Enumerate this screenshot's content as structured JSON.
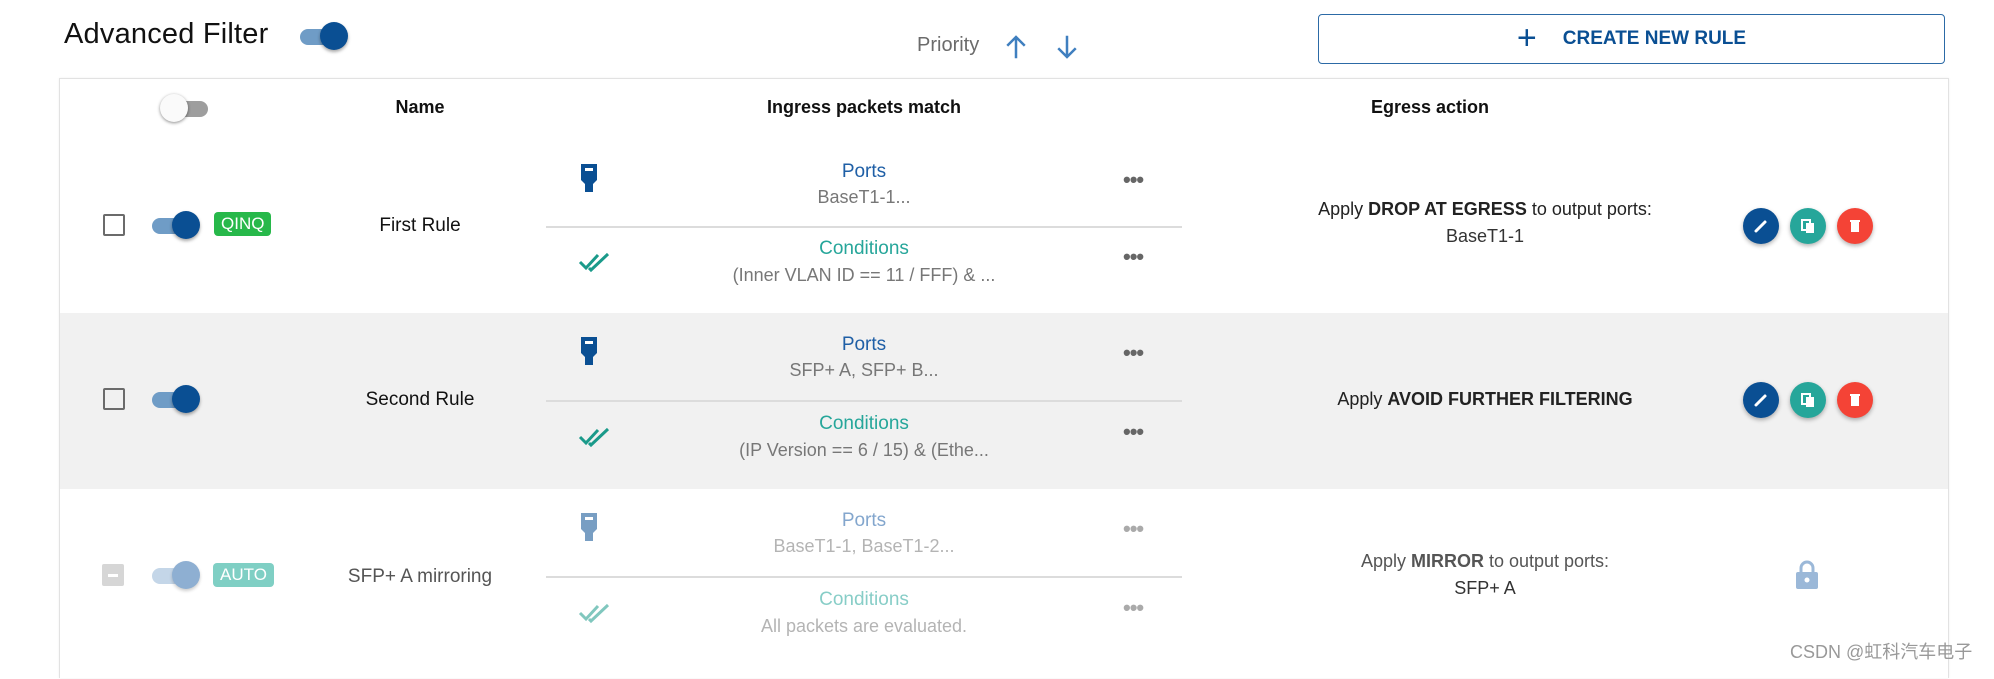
{
  "header": {
    "title": "Advanced Filter",
    "filter_enabled": true,
    "priority_label": "Priority",
    "create_button_label": "CREATE NEW RULE"
  },
  "table": {
    "columns": {
      "select_all_toggle": false,
      "name": "Name",
      "ingress": "Ingress packets match",
      "egress": "Egress action"
    },
    "rows": [
      {
        "checked": false,
        "enabled": true,
        "badge": "QINQ",
        "badge_color": "#27b84a",
        "name": "First Rule",
        "ports_label": "Ports",
        "ports_value": "BaseT1-1...",
        "conditions_label": "Conditions",
        "conditions_value": "(Inner VLAN ID == 11 / FFF) & ...",
        "egress_prefix": "Apply ",
        "egress_action": "DROP AT EGRESS",
        "egress_suffix": " to output ports:",
        "egress_ports": "BaseT1-1",
        "locked": false
      },
      {
        "checked": false,
        "enabled": true,
        "badge": "",
        "name": "Second Rule",
        "ports_label": "Ports",
        "ports_value": "SFP+ A, SFP+ B...",
        "conditions_label": "Conditions",
        "conditions_value": "(IP Version == 6 / 15) & (Ethe...",
        "egress_prefix": "Apply ",
        "egress_action": "AVOID FURTHER FILTERING",
        "egress_suffix": "",
        "egress_ports": "",
        "locked": false
      },
      {
        "checked": "indeterminate",
        "enabled": true,
        "disabled": true,
        "badge": "AUTO",
        "badge_color": "#7fcfc4",
        "name": "SFP+ A mirroring",
        "ports_label": "Ports",
        "ports_value": "BaseT1-1, BaseT1-2...",
        "conditions_label": "Conditions",
        "conditions_value": "All packets are evaluated.",
        "egress_prefix": "Apply ",
        "egress_action": "MIRROR",
        "egress_suffix": " to output ports:",
        "egress_ports": "SFP+ A",
        "locked": true
      }
    ]
  },
  "colors": {
    "primary": "#0a4f93",
    "teal": "#26a69a",
    "red": "#f44336",
    "row_alt": "#f1f1f1"
  },
  "icons": {
    "ports": "ethernet-port-icon",
    "conditions": "double-check-icon",
    "more": "more-horizontal-icon",
    "edit": "pencil-icon",
    "copy": "copy-icon",
    "delete": "trash-icon",
    "lock": "lock-icon",
    "up": "arrow-up-icon",
    "down": "arrow-down-icon",
    "plus": "plus-icon"
  },
  "watermark": "CSDN @虹科汽车电子"
}
